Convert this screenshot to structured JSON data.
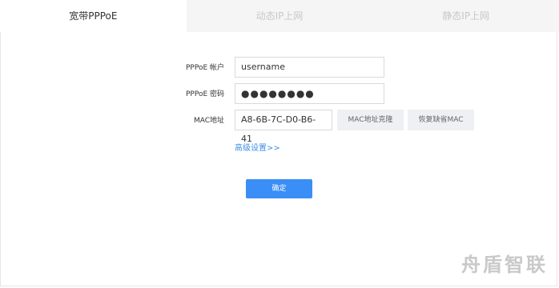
{
  "tabs": [
    {
      "label": "宽带PPPoE",
      "active": true
    },
    {
      "label": "动态IP上网",
      "active": false
    },
    {
      "label": "静态IP上网",
      "active": false
    }
  ],
  "form": {
    "pppoe_account_label": "PPPoE 帐户",
    "pppoe_account_value": "username",
    "pppoe_password_label": "PPPoE 密码",
    "pppoe_password_value": "●●●●●●●●",
    "mac_label": "MAC地址",
    "mac_value": "A8-6B-7C-D0-B6-41",
    "mac_clone_button": "MAC地址克隆",
    "restore_mac_button": "恢复缺省MAC",
    "advanced_link": "高级设置>>",
    "confirm_button": "确定"
  },
  "watermark": "舟盾智联",
  "colors": {
    "primary": "#3a8ef6",
    "link": "#3b8fe6",
    "tab_inactive_bg": "#f5f5f5"
  }
}
